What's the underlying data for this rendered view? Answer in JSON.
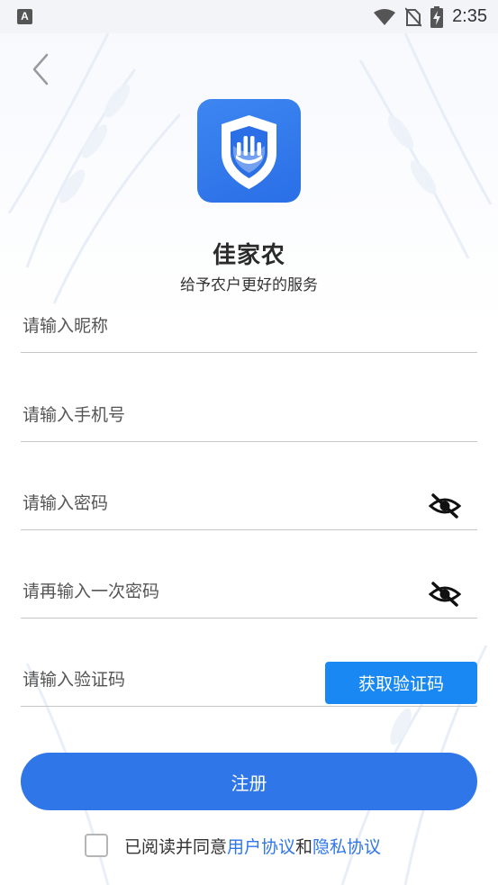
{
  "status_bar": {
    "time": "2:35",
    "app_icon_letter": "A"
  },
  "app": {
    "name": "佳家农",
    "slogan": "给予农户更好的服务"
  },
  "form": {
    "nickname_placeholder": "请输入昵称",
    "phone_placeholder": "请输入手机号",
    "password_placeholder": "请输入密码",
    "password_confirm_placeholder": "请再输入一次密码",
    "code_placeholder": "请输入验证码",
    "get_code_label": "获取验证码"
  },
  "register_label": "注册",
  "agreement": {
    "prefix": "已阅读并同意",
    "user_agreement": "用户协议",
    "and": "和",
    "privacy_agreement": "隐私协议",
    "checked": false
  },
  "colors": {
    "primary": "#2f76e9",
    "code_button": "#1a88f2",
    "logo": "#2a6fe6"
  },
  "icons": [
    "back-arrow-icon",
    "shield-logo-icon",
    "eye-off-icon",
    "wifi-icon",
    "no-sim-icon",
    "battery-charging-icon"
  ]
}
